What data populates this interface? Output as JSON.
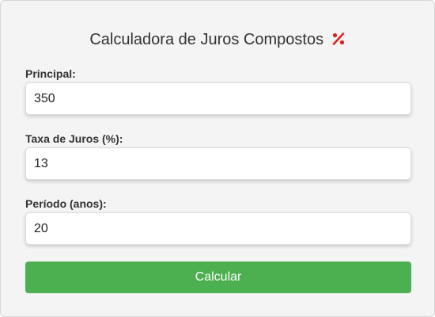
{
  "calculator": {
    "title": "Calculadora de Juros Compostos",
    "title_icon": "percent-icon",
    "accent_color": "#e02020",
    "fields": [
      {
        "label": "Principal:",
        "value": "350"
      },
      {
        "label": "Taxa de Juros (%):",
        "value": "13"
      },
      {
        "label": "Período (anos):",
        "value": "20"
      }
    ],
    "button_label": "Calcular",
    "button_color": "#4caf50"
  }
}
